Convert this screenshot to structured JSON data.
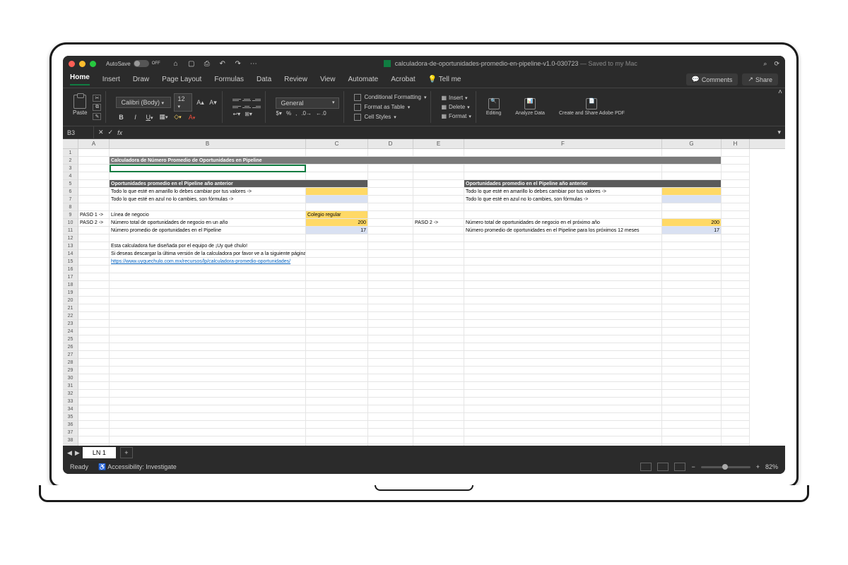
{
  "titlebar": {
    "autosave_label": "AutoSave",
    "autosave_state": "OFF",
    "filename": "calculadora-de-oportunidades-promedio-en-pipeline-v1.0-030723",
    "saved_suffix": " — Saved to my Mac"
  },
  "tabs": {
    "items": [
      "Home",
      "Insert",
      "Draw",
      "Page Layout",
      "Formulas",
      "Data",
      "Review",
      "View",
      "Automate",
      "Acrobat"
    ],
    "tellme": "Tell me",
    "comments": "Comments",
    "share": "Share"
  },
  "ribbon": {
    "paste": "Paste",
    "font_name": "Calibri (Body)",
    "font_size": "12",
    "number_format": "General",
    "cond_fmt": "Conditional Formatting",
    "fmt_table": "Format as Table",
    "cell_styles": "Cell Styles",
    "insert": "Insert",
    "delete": "Delete",
    "format": "Format",
    "editing": "Editing",
    "analyze": "Analyze Data",
    "adobe": "Create and Share Adobe PDF"
  },
  "namebox": "B3",
  "columns": [
    "A",
    "B",
    "C",
    "D",
    "E",
    "F",
    "G",
    "H"
  ],
  "sheet": {
    "title": "Calculadora de Número Promedio de Oportunidades en Pipeline",
    "section1": "Oportunidades promedio en el Pipeline año anterior",
    "section2": "Oportunidades promedio en el Pipeline año anterior",
    "hint_yellow": "Todo lo que esté en amarillo lo debes cambiar por tus valores ->",
    "hint_blue": "Todo lo que esté en azul no lo cambies, son fórmulas ->",
    "paso1": "PASO 1 ->",
    "paso2": "PASO 2 ->",
    "linea": "Línea de negocio",
    "colegio": "Colegio regular",
    "total_ops": "Número total de oportunidades de negocio en un año",
    "val200": "200",
    "promedio": "Número promedio de oportunidades en el Pipeline",
    "val17": "17",
    "total_ops2": "Número total de oportunidades de negocio en el próximo año",
    "promedio2": "Número promedio de oportunidades en el Pipeline para los próximos 12 meses",
    "credit": "Esta calculadora fue diseñada por el equipo de ¡Uy qué chulo!",
    "download": "Si deseas descargar la última versión de la calculadora por favor ve a la siguiente página:",
    "url": "https://www.uyquechulo.com.mx/recursos/lp/calculadora-promedio-oportunidades/"
  },
  "sheettab": "LN 1",
  "status": {
    "ready": "Ready",
    "access": "Accessibility: Investigate",
    "zoom": "82%"
  }
}
